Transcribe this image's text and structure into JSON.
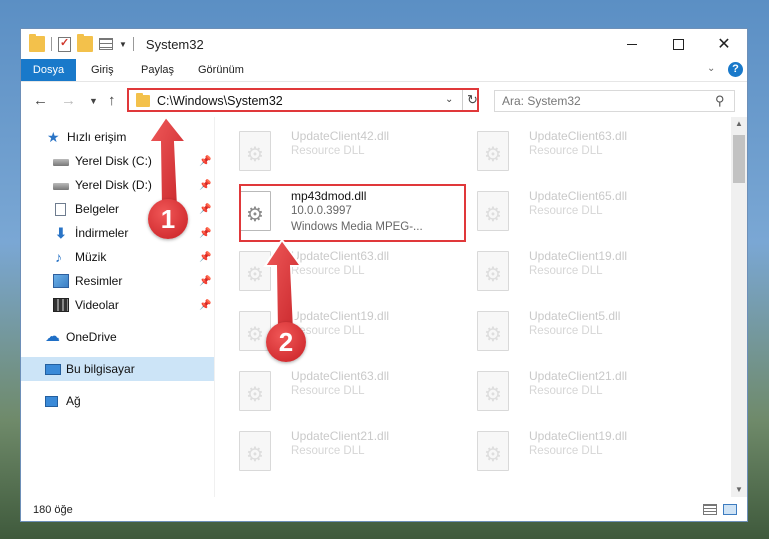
{
  "window": {
    "title": "System32",
    "controls": {
      "minimize": "—",
      "maximize": "☐",
      "close": "✕"
    }
  },
  "ribbon": {
    "tabs": [
      {
        "label": "Dosya",
        "active": true
      },
      {
        "label": "Giriş"
      },
      {
        "label": "Paylaş"
      },
      {
        "label": "Görünüm"
      }
    ],
    "help": "?"
  },
  "address": {
    "path": "C:\\Windows\\System32",
    "search_placeholder": "Ara: System32"
  },
  "sidebar": {
    "items": [
      {
        "label": "Hızlı erişim",
        "icon": "star-icon"
      },
      {
        "label": "Yerel Disk (C:)",
        "icon": "drive-icon",
        "pinned": true
      },
      {
        "label": "Yerel Disk (D:)",
        "icon": "drive-icon",
        "pinned": true
      },
      {
        "label": "Belgeler",
        "icon": "documents-icon",
        "pinned": true
      },
      {
        "label": "İndirmeler",
        "icon": "download-icon",
        "pinned": true
      },
      {
        "label": "Müzik",
        "icon": "music-icon",
        "pinned": true
      },
      {
        "label": "Resimler",
        "icon": "pictures-icon",
        "pinned": true
      },
      {
        "label": "Videolar",
        "icon": "videos-icon",
        "pinned": true
      },
      {
        "label": "OneDrive",
        "icon": "onedrive-icon"
      },
      {
        "label": "Bu bilgisayar",
        "icon": "this-pc-icon",
        "selected": true
      },
      {
        "label": "Ağ",
        "icon": "network-icon"
      }
    ]
  },
  "files": {
    "highlighted": {
      "name": "mp43dmod.dll",
      "version": "10.0.0.3997",
      "description": "Windows Media MPEG-..."
    },
    "left_column": [
      {
        "name": "UpdateClient42.dll",
        "desc": "Resource DLL"
      },
      {
        "name": "UpdateClient63.dll",
        "desc": "Resource DLL"
      },
      {
        "name": "UpdateClient19.dll",
        "desc": "Resource DLL"
      },
      {
        "name": "UpdateClient63.dll",
        "desc": "Resource DLL"
      },
      {
        "name": "UpdateClient21.dll",
        "desc": "Resource DLL"
      }
    ],
    "right_column": [
      {
        "name": "UpdateClient63.dll",
        "desc": "Resource DLL"
      },
      {
        "name": "UpdateClient65.dll",
        "desc": "Resource DLL"
      },
      {
        "name": "UpdateClient19.dll",
        "desc": "Resource DLL"
      },
      {
        "name": "UpdateClient5.dll",
        "desc": "Resource DLL"
      },
      {
        "name": "UpdateClient21.dll",
        "desc": "Resource DLL"
      },
      {
        "name": "UpdateClient19.dll",
        "desc": "Resource DLL"
      }
    ]
  },
  "status": {
    "count": "180 öğe"
  },
  "annotations": {
    "step1": "1",
    "step2": "2"
  },
  "colors": {
    "accent": "#1979ca",
    "highlight": "#e0383a",
    "selected": "#cce4f7"
  }
}
